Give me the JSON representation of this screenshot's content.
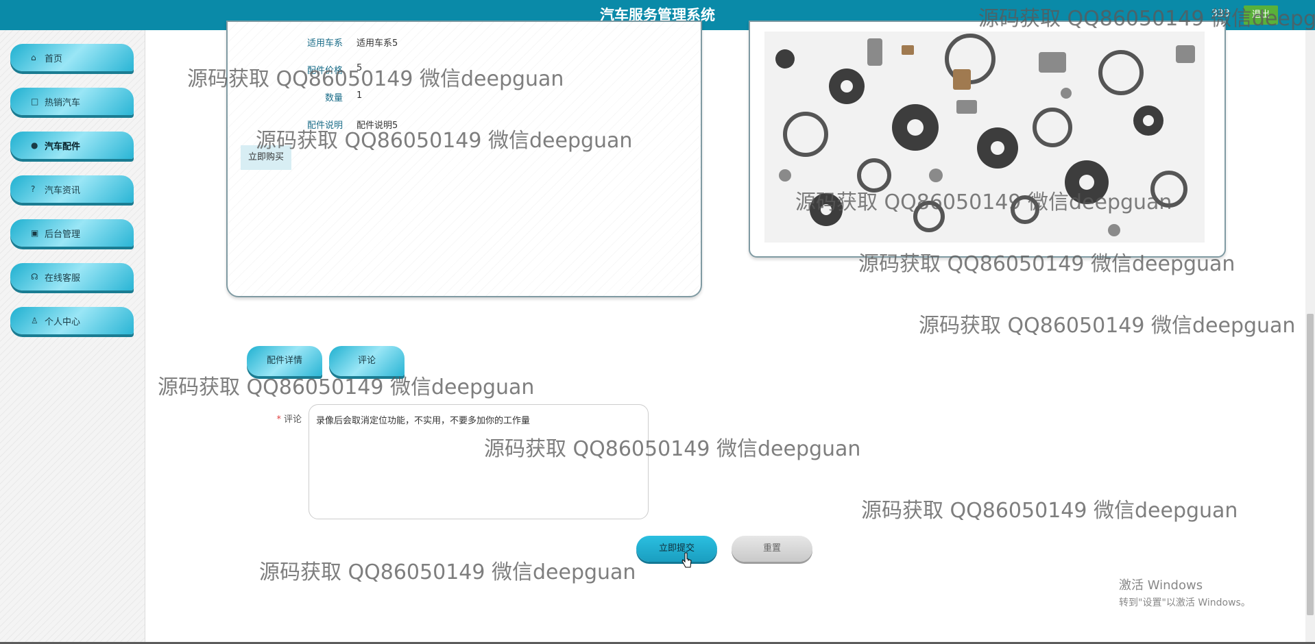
{
  "header": {
    "title": "汽车服务管理系统",
    "user": "333",
    "logout_label": "退出"
  },
  "sidebar": {
    "items": [
      {
        "label": "首页",
        "icon": "home-icon"
      },
      {
        "label": "热销汽车",
        "icon": "bag-icon"
      },
      {
        "label": "汽车配件",
        "icon": "info-icon",
        "active": true
      },
      {
        "label": "汽车资讯",
        "icon": "question-icon"
      },
      {
        "label": "后台管理",
        "icon": "briefcase-icon"
      },
      {
        "label": "在线客服",
        "icon": "headset-icon"
      },
      {
        "label": "个人中心",
        "icon": "user-icon"
      }
    ]
  },
  "details": {
    "series_label": "适用车系",
    "series_value": "适用车系5",
    "price_label": "配件价格",
    "price_value": "5",
    "quantity_label": "数量",
    "quantity_value": "1",
    "desc_label": "配件说明",
    "desc_value": "配件说明5",
    "buy_label": "立即购买"
  },
  "tabs": {
    "detail_label": "配件详情",
    "comment_label": "评论"
  },
  "comment_form": {
    "label": "评论",
    "required_mark": "*",
    "value": "录像后会取消定位功能，不实用，不要多加你的工作量",
    "submit_label": "立即提交",
    "reset_label": "重置"
  },
  "watermark_text": "源码获取 QQ86050149 微信deepguan",
  "windows_activation": {
    "title": "激活 Windows",
    "subtitle": "转到\"设置\"以激活 Windows。"
  }
}
